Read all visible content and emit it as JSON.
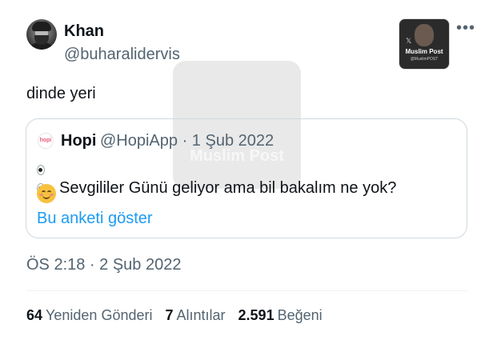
{
  "author": {
    "name": "Khan",
    "handle": "@buharalidervis"
  },
  "more_menu_label": "•••",
  "tweet_text": "dinde yeri",
  "watermark": {
    "label": "Muslim Post",
    "sub": "@MuslimPOST",
    "x_glyph": "𝕏"
  },
  "quoted": {
    "avatar_text": "hopi",
    "name": "Hopi",
    "meta": "@HopiApp · 1 Şub 2022",
    "text": "Sevgililer Günü geliyor ama bil bakalım ne yok?",
    "poll_link": "Bu anketi göster"
  },
  "timestamp": "ÖS 2:18 · 2 Şub 2022",
  "stats": [
    {
      "count": "64",
      "label": "Yeniden Gönderi"
    },
    {
      "count": "7",
      "label": "Alıntılar"
    },
    {
      "count": "2.591",
      "label": "Beğeni"
    }
  ],
  "colors": {
    "link": "#1d9bf0",
    "secondary_text": "#536471",
    "border": "#cfd9de"
  }
}
